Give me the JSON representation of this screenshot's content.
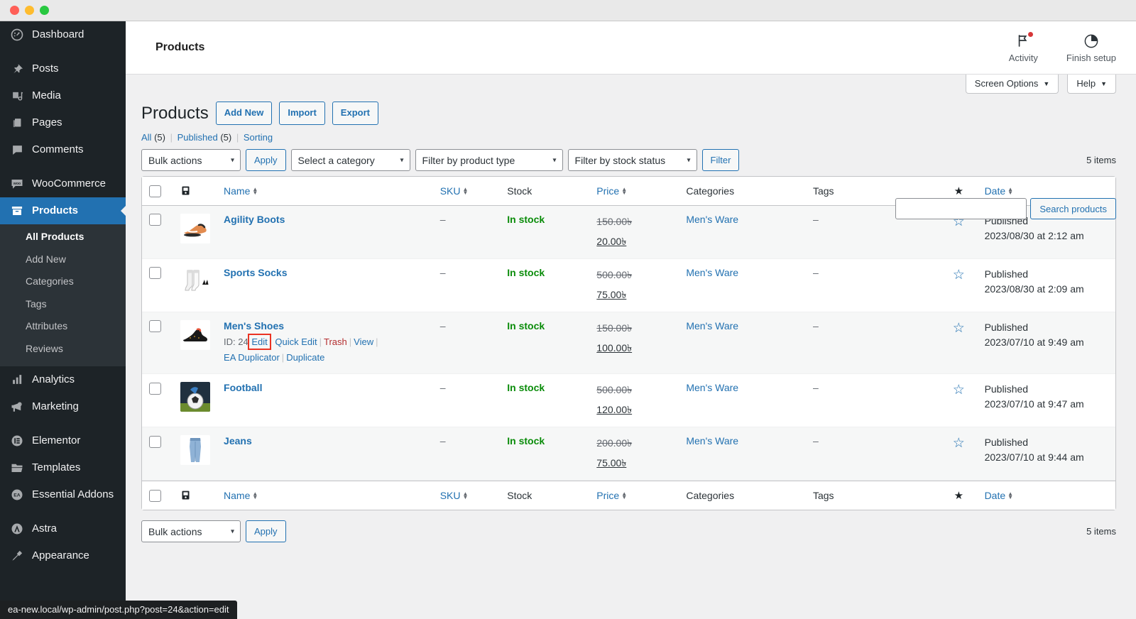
{
  "window": {
    "traffic_lights": [
      "close",
      "minimize",
      "zoom"
    ]
  },
  "sidebar": {
    "items": [
      {
        "label": "Dashboard",
        "icon": "dashboard-icon",
        "current": false
      },
      {
        "label": "Posts",
        "icon": "pin-icon",
        "current": false
      },
      {
        "label": "Media",
        "icon": "media-icon",
        "current": false
      },
      {
        "label": "Pages",
        "icon": "pages-icon",
        "current": false
      },
      {
        "label": "Comments",
        "icon": "comments-icon",
        "current": false
      },
      {
        "label": "WooCommerce",
        "icon": "woocommerce-icon",
        "current": false
      },
      {
        "label": "Products",
        "icon": "products-icon",
        "current": true
      },
      {
        "label": "Analytics",
        "icon": "analytics-icon",
        "current": false
      },
      {
        "label": "Marketing",
        "icon": "marketing-icon",
        "current": false
      },
      {
        "label": "Elementor",
        "icon": "elementor-icon",
        "current": false
      },
      {
        "label": "Templates",
        "icon": "templates-icon",
        "current": false
      },
      {
        "label": "Essential Addons",
        "icon": "essential-addons-icon",
        "current": false
      },
      {
        "label": "Astra",
        "icon": "astra-icon",
        "current": false
      },
      {
        "label": "Appearance",
        "icon": "appearance-icon",
        "current": false
      }
    ],
    "submenu": [
      {
        "label": "All Products",
        "current": true
      },
      {
        "label": "Add New",
        "current": false
      },
      {
        "label": "Categories",
        "current": false
      },
      {
        "label": "Tags",
        "current": false
      },
      {
        "label": "Attributes",
        "current": false
      },
      {
        "label": "Reviews",
        "current": false
      }
    ]
  },
  "woo_header": {
    "title": "Products",
    "actions": [
      {
        "label": "Activity",
        "icon": "flag-icon",
        "has_badge": true
      },
      {
        "label": "Finish setup",
        "icon": "progress-circle-icon",
        "has_badge": false
      }
    ]
  },
  "screen_meta": {
    "screen_options": "Screen Options",
    "help": "Help",
    "caret": "▼"
  },
  "page": {
    "title": "Products",
    "buttons": [
      {
        "label": "Add New"
      },
      {
        "label": "Import"
      },
      {
        "label": "Export"
      }
    ],
    "views": [
      {
        "label": "All",
        "count": "(5)"
      },
      {
        "label": "Published",
        "count": "(5)"
      },
      {
        "label": "Sorting",
        "count": ""
      }
    ],
    "separator": "|"
  },
  "search": {
    "value": "",
    "placeholder": "",
    "submit_label": "Search products"
  },
  "tablenav_top": {
    "bulk_actions": "Bulk actions",
    "apply_label": "Apply",
    "category_filter": "Select a category",
    "type_filter": "Filter by product type",
    "stock_filter": "Filter by stock status",
    "filter_label": "Filter",
    "items_count": "5 items"
  },
  "tablenav_bottom": {
    "bulk_actions": "Bulk actions",
    "apply_label": "Apply",
    "items_count": "5 items"
  },
  "table": {
    "columns": [
      {
        "key": "cb",
        "label": "",
        "sortable": false
      },
      {
        "key": "thumb",
        "label": "",
        "sortable": false,
        "icon": "image-icon"
      },
      {
        "key": "name",
        "label": "Name",
        "sortable": true
      },
      {
        "key": "sku",
        "label": "SKU",
        "sortable": true
      },
      {
        "key": "stock",
        "label": "Stock",
        "sortable": false
      },
      {
        "key": "price",
        "label": "Price",
        "sortable": true
      },
      {
        "key": "categories",
        "label": "Categories",
        "sortable": false
      },
      {
        "key": "tags",
        "label": "Tags",
        "sortable": false
      },
      {
        "key": "featured",
        "label": "",
        "sortable": false,
        "icon": "star-icon"
      },
      {
        "key": "date",
        "label": "Date",
        "sortable": true
      }
    ],
    "rows": [
      {
        "name": "Agility Boots",
        "thumb": "football-boot",
        "id": "",
        "actions": [],
        "sku": "–",
        "stock": "In stock",
        "price_old": "150.00৳",
        "price_new": "20.00৳",
        "categories": "Men's Ware",
        "tags": "–",
        "featured": "star-outline",
        "status": "Published",
        "date": "2023/08/30 at 2:12 am"
      },
      {
        "name": "Sports Socks",
        "thumb": "socks",
        "id": "",
        "actions": [],
        "sku": "–",
        "stock": "In stock",
        "price_old": "500.00৳",
        "price_new": "75.00৳",
        "categories": "Men's Ware",
        "tags": "–",
        "featured": "star-outline",
        "status": "Published",
        "date": "2023/08/30 at 2:09 am"
      },
      {
        "name": "Men's Shoes",
        "thumb": "sneaker",
        "id": "ID: 24",
        "actions": [
          {
            "label": "Edit",
            "kind": "edit",
            "highlighted": true
          },
          {
            "label": "Quick Edit",
            "kind": "quick-edit",
            "highlighted": false
          },
          {
            "label": "Trash",
            "kind": "trash",
            "highlighted": false
          },
          {
            "label": "View",
            "kind": "view",
            "highlighted": false
          },
          {
            "label": "EA Duplicator",
            "kind": "ea-duplicator",
            "highlighted": false
          },
          {
            "label": "Duplicate",
            "kind": "duplicate",
            "highlighted": false
          }
        ],
        "sku": "–",
        "stock": "In stock",
        "price_old": "150.00৳",
        "price_new": "100.00৳",
        "categories": "Men's Ware",
        "tags": "–",
        "featured": "star-outline",
        "status": "Published",
        "date": "2023/07/10 at 9:49 am"
      },
      {
        "name": "Football",
        "thumb": "football",
        "id": "",
        "actions": [],
        "sku": "–",
        "stock": "In stock",
        "price_old": "500.00৳",
        "price_new": "120.00৳",
        "categories": "Men's Ware",
        "tags": "–",
        "featured": "star-outline",
        "status": "Published",
        "date": "2023/07/10 at 9:47 am"
      },
      {
        "name": "Jeans",
        "thumb": "jeans",
        "id": "",
        "actions": [],
        "sku": "–",
        "stock": "In stock",
        "price_old": "200.00৳",
        "price_new": "75.00৳",
        "categories": "Men's Ware",
        "tags": "–",
        "featured": "star-outline",
        "status": "Published",
        "date": "2023/07/10 at 9:44 am"
      }
    ]
  },
  "status_bar": {
    "url": "ea-new.local/wp-admin/post.php?post=24&action=edit"
  },
  "colors": {
    "sidebar_bg": "#1d2327",
    "sidebar_submenu_bg": "#2c3338",
    "accent_blue": "#2271b1",
    "current_menu": "#2271b1",
    "in_stock_green": "#0a8c0a",
    "trash_red": "#b32d2e",
    "highlight_red": "#ea3323",
    "page_bg": "#f0f0f1"
  }
}
